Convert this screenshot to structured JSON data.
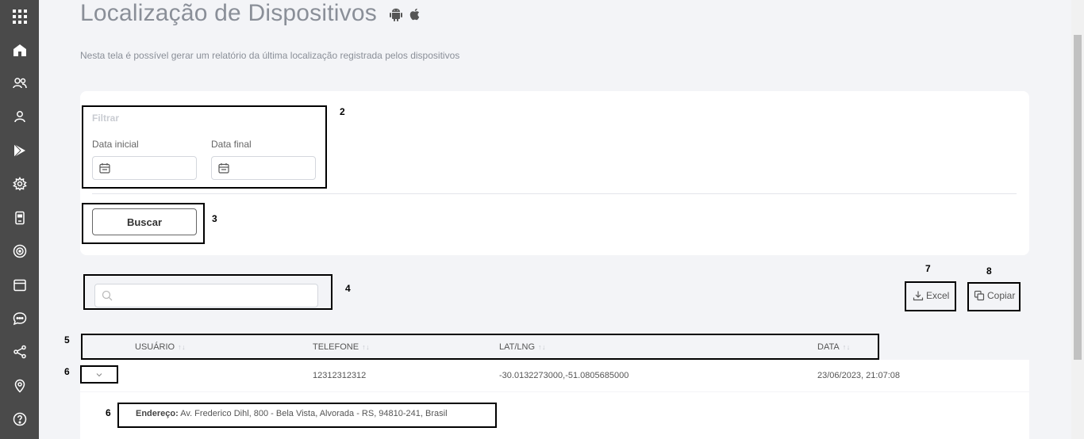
{
  "header": {
    "title": "Localização de Dispositivos",
    "subtitle": "Nesta tela é possível gerar um relatório da última localização registrada pelos dispositivos",
    "os_icons": [
      "android-icon",
      "apple-icon"
    ]
  },
  "sidebar": {
    "items": [
      {
        "icon": "apps-grid-icon"
      },
      {
        "icon": "home-icon"
      },
      {
        "icon": "users-icon"
      },
      {
        "icon": "user-icon"
      },
      {
        "icon": "play-store-icon"
      },
      {
        "icon": "settings-icon"
      },
      {
        "icon": "device-icon"
      },
      {
        "icon": "radar-icon"
      },
      {
        "icon": "browser-icon"
      },
      {
        "icon": "chat-icon"
      },
      {
        "icon": "share-icon"
      },
      {
        "icon": "location-pin-icon"
      },
      {
        "icon": "help-icon"
      }
    ]
  },
  "filter": {
    "label": "Filtrar",
    "start_date_label": "Data inicial",
    "end_date_label": "Data final",
    "start_date_value": "",
    "end_date_value": "",
    "search_button": "Buscar"
  },
  "search": {
    "placeholder": ""
  },
  "export": {
    "excel_label": "Excel",
    "copy_label": "Copiar"
  },
  "table": {
    "columns": [
      "USUÁRIO",
      "TELEFONE",
      "LAT/LNG",
      "DATA"
    ],
    "rows": [
      {
        "usuario": "",
        "telefone": "12312312312",
        "latlng": "-30.0132273000,-51.0805685000",
        "data": "23/06/2023, 21:07:08",
        "address_label": "Endereço:",
        "address": "Av. Frederico Dihl, 800 - Bela Vista, Alvorada - RS, 94810-241, Brasil"
      }
    ]
  },
  "annotations": [
    "2",
    "3",
    "4",
    "5",
    "6",
    "6",
    "7",
    "8"
  ],
  "colors": {
    "sidebar": "#4a4a4a",
    "background": "#f3f4f7",
    "card": "#ffffff",
    "annotation": "#000000"
  }
}
